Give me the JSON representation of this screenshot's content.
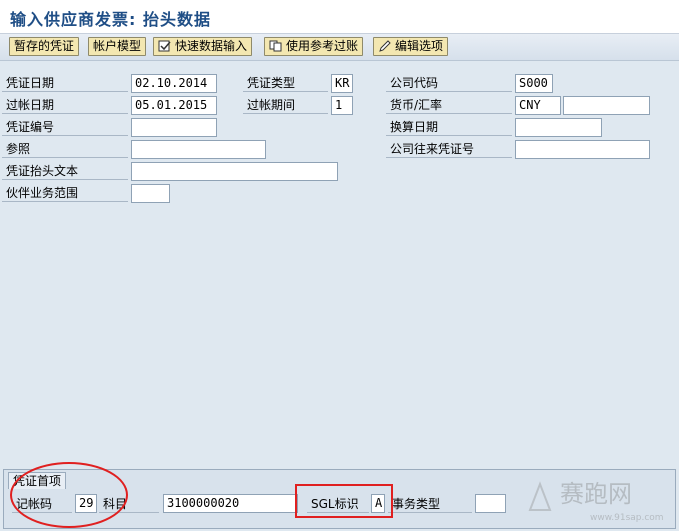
{
  "window": {
    "title": "输入供应商发票: 抬头数据"
  },
  "toolbar": {
    "buttons": [
      "暂存的凭证",
      "帐户模型",
      "快速数据输入",
      "使用参考过账",
      "编辑选项"
    ]
  },
  "fields": {
    "doc_date": {
      "label": "凭证日期",
      "value": "02.10.2014"
    },
    "posting_date": {
      "label": "过帐日期",
      "value": "05.01.2015"
    },
    "doc_number": {
      "label": "凭证编号",
      "value": ""
    },
    "reference": {
      "label": "参照",
      "value": ""
    },
    "header_text": {
      "label": "凭证抬头文本",
      "value": ""
    },
    "partner_area": {
      "label": "伙伴业务范围",
      "value": ""
    },
    "doc_type": {
      "label": "凭证类型",
      "value": "KR"
    },
    "period": {
      "label": "过帐期间",
      "value": "1"
    },
    "company_code": {
      "label": "公司代码",
      "value": "S000"
    },
    "currency": {
      "label": "货币/汇率",
      "value": "CNY",
      "rate": ""
    },
    "translation_date": {
      "label": "换算日期",
      "value": ""
    },
    "intercompany_no": {
      "label": "公司往来凭证号",
      "value": ""
    }
  },
  "first_item": {
    "tab": "凭证首项",
    "posting_key": {
      "label": "记帐码",
      "value": "29"
    },
    "account": {
      "label": "科目",
      "value": "3100000020"
    },
    "sgl": {
      "label": "SGL标识",
      "value": "A"
    },
    "trans_type": {
      "label": "事务类型",
      "value": ""
    }
  },
  "watermark": {
    "text": "赛跑网",
    "url": "www.91sap.com"
  },
  "colors": {
    "annotation": "#e02020",
    "title": "#1f4e86",
    "button": "#f3e7b1"
  }
}
